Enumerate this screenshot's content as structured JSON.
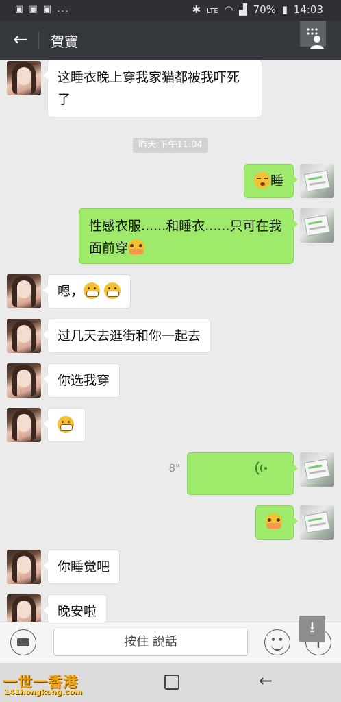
{
  "status_bar": {
    "left_text": "▣ ▣ ▣ ...",
    "network": "LTE",
    "battery": "70%",
    "time": "14:03"
  },
  "header": {
    "back_icon": "arrow-left-icon",
    "title": "賀寶",
    "profile_icon": "chat-info-icon"
  },
  "messages": [
    {
      "side": "left",
      "text": "这睡衣晚上穿我家猫都被我吓死了"
    },
    {
      "type": "timestamp",
      "text": "昨天 下午11:04"
    },
    {
      "side": "right",
      "emoji": "sleepy",
      "text": "睡"
    },
    {
      "side": "right",
      "text": "性感衣服......和睡衣......只可在我面前穿",
      "emoji": "shy"
    },
    {
      "side": "left",
      "text": "嗯，",
      "emojis": [
        "grin",
        "grin"
      ]
    },
    {
      "side": "left",
      "text": "过几天去逛街和你一起去"
    },
    {
      "side": "left",
      "text": "你选我穿"
    },
    {
      "side": "left",
      "emoji": "grin"
    },
    {
      "side": "right",
      "type": "voice",
      "duration": "8\""
    },
    {
      "side": "right",
      "emoji": "shy"
    },
    {
      "side": "left",
      "text": "你睡觉吧"
    },
    {
      "side": "left",
      "text": "晚安啦"
    }
  ],
  "input_bar": {
    "hold_to_talk": "按住 說話"
  },
  "watermark": {
    "brand": "一世一香港",
    "url": "141hongkong.com"
  }
}
